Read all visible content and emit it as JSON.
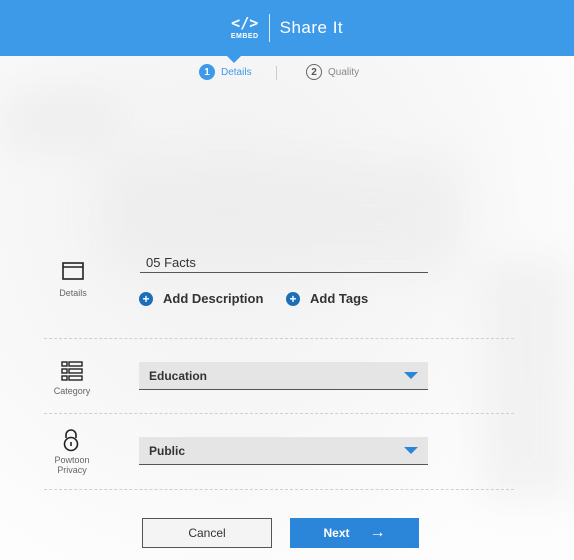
{
  "header": {
    "logo_glyph": "</>",
    "logo_text": "EMBED",
    "title": "Share It",
    "color": "#3d9ae8"
  },
  "steps": [
    {
      "number": "1",
      "label": "Details",
      "active": true
    },
    {
      "number": "2",
      "label": "Quality",
      "active": false
    }
  ],
  "details": {
    "label": "Details",
    "icon": "details-icon",
    "title_value": "05 Facts",
    "add_description": "Add Description",
    "add_tags": "Add Tags"
  },
  "category": {
    "label": "Category",
    "icon": "list-icon",
    "selected": "Education"
  },
  "privacy": {
    "label_line1": "Powtoon",
    "label_line2": "Privacy",
    "icon": "lock-icon",
    "selected": "Public"
  },
  "footer": {
    "cancel_label": "Cancel",
    "next_label": "Next",
    "next_color": "#2b85d8"
  }
}
